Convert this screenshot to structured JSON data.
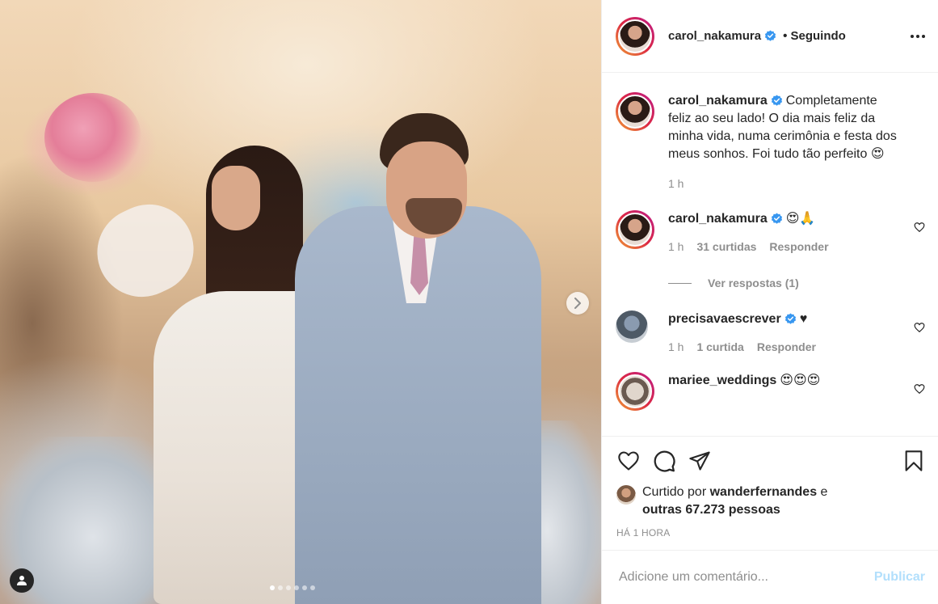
{
  "post": {
    "author": "carol_nakamura",
    "follow_status": "• Seguindo",
    "photo_count": 6,
    "active_photo": 0
  },
  "caption": {
    "user": "carol_nakamura",
    "text": "Completamente feliz ao seu lado! O dia mais feliz da minha vida, numa cerimônia e festa dos meus sonhos. Foi tudo tão perfeito 😍",
    "time": "1 h"
  },
  "comments": [
    {
      "user": "carol_nakamura",
      "text": "😍🙏",
      "time": "1 h",
      "likes": "31 curtidas",
      "reply_label": "Responder",
      "view_replies": "Ver respostas (1)"
    },
    {
      "user": "precisavaescrever",
      "text": "♥",
      "time": "1 h",
      "likes": "1 curtida",
      "reply_label": "Responder"
    },
    {
      "user": "mariee_weddings",
      "text": "😍😍😍"
    }
  ],
  "likes": {
    "prefix": "Curtido por",
    "user": "wanderfernandes",
    "connector": "e",
    "others": "outras 67.273 pessoas"
  },
  "timestamp": "HÁ 1 HORA",
  "comment_box": {
    "placeholder": "Adicione um comentário...",
    "publish_label": "Publicar"
  },
  "colors": {
    "verified": "#3897f0",
    "publish_disabled": "#b2dffc"
  }
}
